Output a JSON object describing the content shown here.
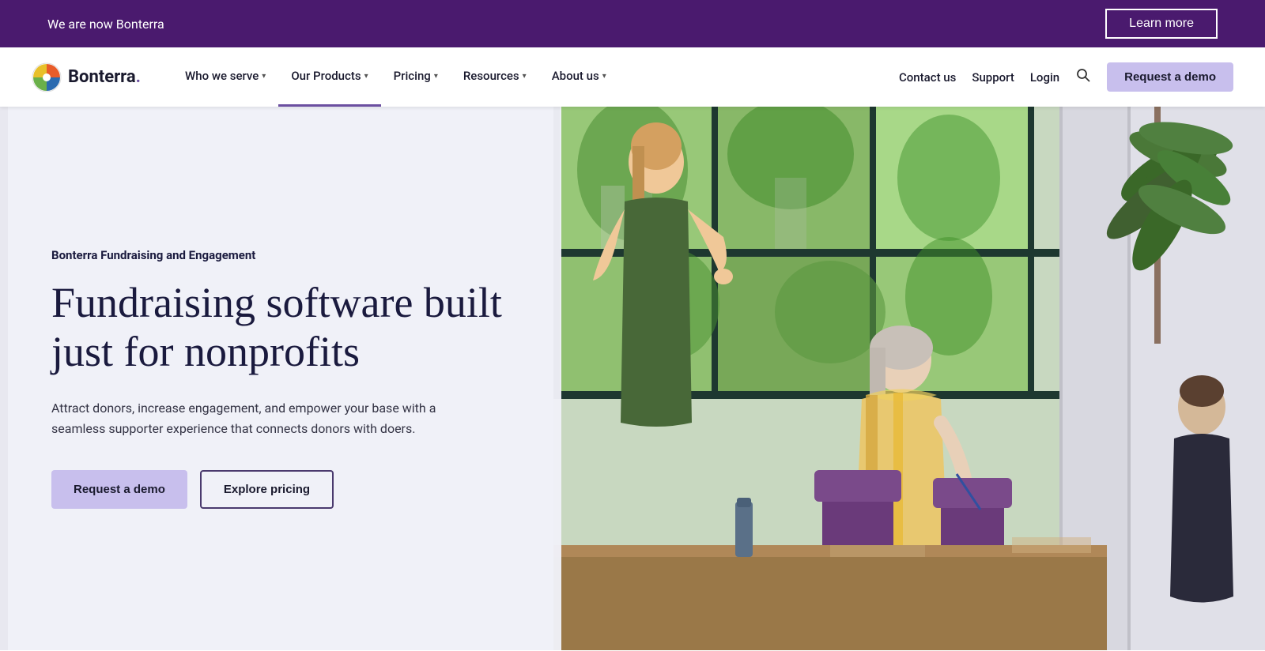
{
  "banner": {
    "text": "We are now Bonterra",
    "learn_more": "Learn more"
  },
  "navbar": {
    "logo_text": "Bonterra",
    "logo_dot": ".",
    "nav_items": [
      {
        "label": "Who we serve",
        "has_dropdown": true,
        "active": false
      },
      {
        "label": "Our Products",
        "has_dropdown": true,
        "active": true
      },
      {
        "label": "Pricing",
        "has_dropdown": true,
        "active": false
      },
      {
        "label": "Resources",
        "has_dropdown": true,
        "active": false
      },
      {
        "label": "About us",
        "has_dropdown": true,
        "active": false
      }
    ],
    "right_links": [
      {
        "label": "Contact us"
      },
      {
        "label": "Support"
      },
      {
        "label": "Login"
      }
    ],
    "request_demo": "Request a demo"
  },
  "hero": {
    "eyebrow": "Bonterra Fundraising and Engagement",
    "title": "Fundraising software built just for nonprofits",
    "description": "Attract donors, increase engagement, and empower your base with a seamless supporter experience that connects donors with doers.",
    "btn_primary": "Request a demo",
    "btn_secondary": "Explore pricing"
  },
  "colors": {
    "purple_dark": "#4a1a6e",
    "purple_mid": "#6b4fa0",
    "purple_light": "#c8bfed",
    "text_dark": "#1a1a3e"
  }
}
